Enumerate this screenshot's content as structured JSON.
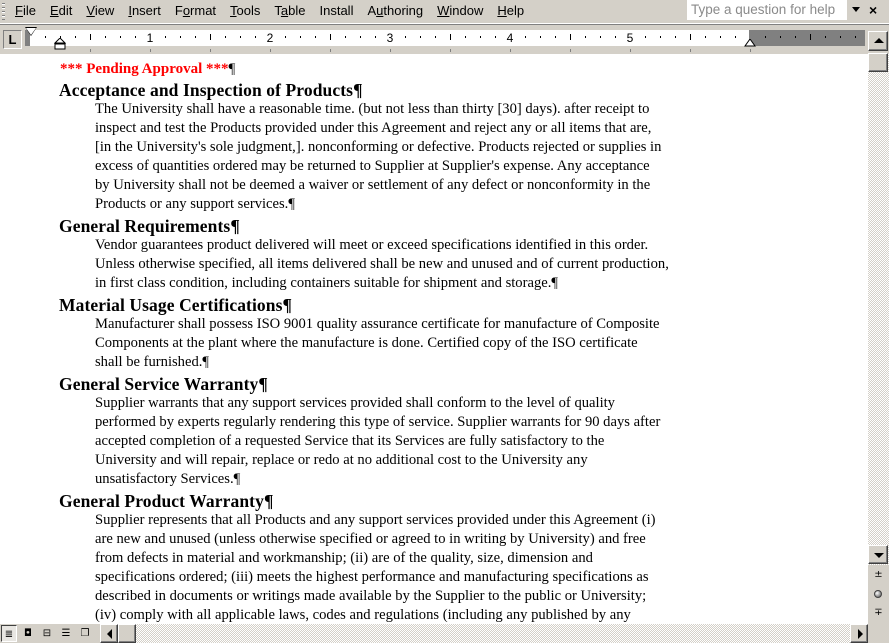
{
  "menubar": {
    "items": [
      {
        "label": "File",
        "accel": "F"
      },
      {
        "label": "Edit",
        "accel": "E"
      },
      {
        "label": "View",
        "accel": "V"
      },
      {
        "label": "Insert",
        "accel": "I"
      },
      {
        "label": "Format",
        "accel": "o"
      },
      {
        "label": "Tools",
        "accel": "T"
      },
      {
        "label": "Table",
        "accel": "a"
      },
      {
        "label": "Install",
        "accel": ""
      },
      {
        "label": "Authoring",
        "accel": "u"
      },
      {
        "label": "Window",
        "accel": "W"
      },
      {
        "label": "Help",
        "accel": "H"
      }
    ],
    "help_placeholder": "Type a question for help",
    "close_glyph": "×"
  },
  "ruler": {
    "tab_selector": "L",
    "numbers": [
      "1",
      "2",
      "3",
      "4",
      "5"
    ]
  },
  "document": {
    "pending_banner": "*** Pending Approval ***",
    "pilcrow": "¶",
    "sections": [
      {
        "heading": "Acceptance and Inspection of Products",
        "lines": [
          "The University shall have a reasonable time. (but not less than thirty [30] days). after receipt to",
          "inspect and test the Products provided under this Agreement and reject any or all items that are,",
          "[in the University's sole judgment,]. nonconforming or defective.  Products rejected or supplies in",
          "excess of quantities ordered may be returned to Supplier at Supplier's expense.  Any acceptance",
          "by University shall not be deemed a waiver or settlement of any defect or nonconformity in the",
          "Products or any support services."
        ]
      },
      {
        "heading": "General Requirements",
        "lines": [
          "Vendor guarantees product delivered will meet or exceed specifications identified in this order.",
          "Unless otherwise specified, all items delivered shall be new and unused and of current production,",
          "in first class condition, including containers suitable for shipment and storage."
        ]
      },
      {
        "heading": "Material Usage Certifications",
        "lines": [
          "Manufacturer shall possess ISO 9001 quality assurance certificate for manufacture of Composite",
          "Components at the plant where the manufacture is done. Certified copy of the ISO certificate",
          "shall be furnished."
        ]
      },
      {
        "heading": "General Service Warranty",
        "lines": [
          "Supplier warrants that any support services provided shall conform to the level of quality",
          "performed by experts regularly rendering this type of service.  Supplier warrants for 90 days after",
          "accepted completion of a requested Service that its Services are fully satisfactory to the",
          "University and will repair, replace or redo at no additional cost to the University any",
          "unsatisfactory Services."
        ]
      },
      {
        "heading": "General Product Warranty",
        "lines": [
          "Supplier represents that all Products and any support services provided under this Agreement (i)",
          "are new and unused (unless otherwise specified or agreed to in writing by University) and free",
          "from defects in material and workmanship; (ii) are of the quality, size, dimension and",
          "specifications ordered; (iii) meets the highest performance and manufacturing specifications as",
          "described in documents or writings made available by the Supplier to the public or University;",
          "(iv) comply with all applicable laws, codes and regulations (including any published by any"
        ]
      }
    ]
  },
  "view_buttons": [
    {
      "name": "normal-view",
      "glyph": "≣"
    },
    {
      "name": "web-layout-view",
      "glyph": "◘"
    },
    {
      "name": "print-layout-view",
      "glyph": "⊟"
    },
    {
      "name": "outline-view",
      "glyph": "☰"
    },
    {
      "name": "reading-layout-view",
      "glyph": "❐"
    }
  ],
  "browse": {
    "prev_glyph": "±",
    "next_glyph": "∓"
  }
}
